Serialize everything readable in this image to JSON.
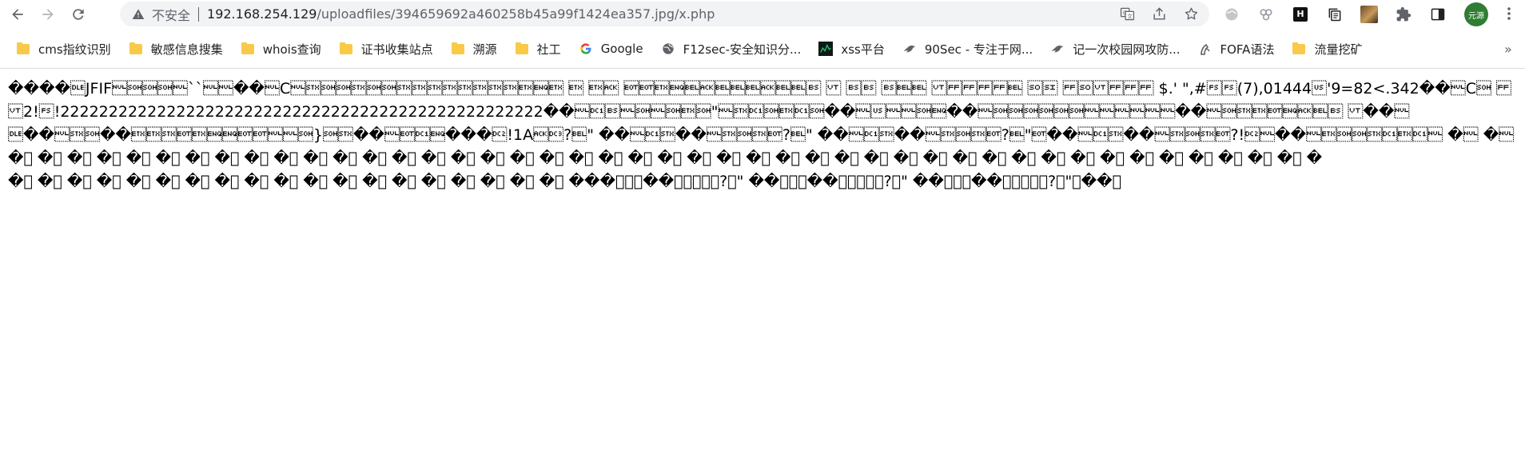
{
  "browser": {
    "security_label": "不安全",
    "url_host": "192.168.254.129",
    "url_path": "/uploadfiles/394659692a460258b45a99f1424ea357.jpg/x.php",
    "avatar_label": "元源",
    "extension_h_label": "H"
  },
  "bookmarks": [
    {
      "label": "cms指纹识别",
      "icon": "folder-icon"
    },
    {
      "label": "敏感信息搜集",
      "icon": "folder-icon"
    },
    {
      "label": "whois查询",
      "icon": "folder-icon"
    },
    {
      "label": "证书收集站点",
      "icon": "folder-icon"
    },
    {
      "label": "溯源",
      "icon": "folder-icon"
    },
    {
      "label": "社工",
      "icon": "folder-icon"
    },
    {
      "label": "Google",
      "icon": "google-icon"
    },
    {
      "label": "F12sec-安全知识分...",
      "icon": "globe-icon"
    },
    {
      "label": "xss平台",
      "icon": "xss-icon"
    },
    {
      "label": "90Sec - 专注于网...",
      "icon": "bird-icon"
    },
    {
      "label": "记一次校园网攻防...",
      "icon": "bird-icon"
    },
    {
      "label": "FOFA语法",
      "icon": "fofa-icon"
    },
    {
      "label": "流量挖矿",
      "icon": "folder-icon"
    }
  ],
  "page": {
    "lines": [
      "����\u0010JFIF\u0000\u0001\u0001\u0001\u0000``\u0000\u0000��\u0000C\u0000\u0002\u0001\u0001\u0002\u0001\u0001\u0002\u0002\u0002\u0002\u0002\u0002\u0002\u0002\u0003\u0005\u0003 \u0003 \u0003\u0006 \u0004\u0004\u0003\u0005\u0007\u0006\u0007\u0007\u0007\u0006\u0007\u0007\b\t\u000b\t\b\b\n\b\u0007\u0007\n\r\n\n\u000b\f\f\f\f\u0007\t\u000e\u000f\r\f\u000e\u000b\f\f\f $.' \",#\u001c\u001c(7),01444\u001f'9=82<.342��\u0000C\u0001 \t\t\t\f",
      "\u000b2!\u001c!22222222222222222222222222222222222222222222222222��\u0000\u0011\b\u0000\u0001\u0000\u0001\u0003\u0001\"\u0000\u0002\u0011\u0001\u0003\u0011\u0001��\u0000\u001f\u0000\u0000\u0001\u0005��\u0000\u0001\u0001\u0001\u0001\u0001\u0001\u0000\u0000\u0000\u0000\u0000\u0000��\u0000\u0001\u0002\u0003\u0004\u0005\u0006\u0007\b\t\n\u000b��\u0000",
      "\u0010��\u0000\u0002\u0001��\u0003\u0003\u0002\u0004\u0003\u0005\u0005\u0004\u0004\u0000\u0000\u0001}\u0001\u0002��\u0000\u0004\u0011\u0005���\u0012!1A\u0006\u0013?\u0007\" ��\u0000\u0011\u0002��\u0000\u0002\u0001\u0002\u0004?\u0007\" ��\u0000\u0011\u0002��\u0000\u0002\u0001\u0002\u0004?\u0007\"\u0004��\u0000\u0011\u0002��\u0000\u0002\u0001\u0002\u0004?!\u0012\u0000��\u0000\u0003\u0001\u0001\u0002\u0011\u0003\u0011\u0000 �\u0000 �\u0000 �\u0000 �\u0000 �\u0000 �\u0000 �\u0000 �",
      "�\u0000 �\u0000 �\u0000 �\u0000 �\u0000 �\u0000 �\u0000 �\u0000 �\u0000 �\u0000 �\u0000 �\u0000 �\u0000 �\u0000 �\u0000 �\u0000 �\u0000 �\u0000 �\u0000 �\u0000 �\u0000 �\u0000 �\u0000 �\u0000 �\u0000 �\u0000 �\u0000 �\u0000 �\u0000 �\u0000 �\u0000 �\u0000 �\u0000 �\u0000 �\u0000 �\u0000 �\u0000 �\u0000 �\u0000 �\u0000 �\u0000 �\u0000 �\u0000 �\u0000 �",
      "�\u0000 �\u0000 �\u0000 �\u0000 �\u0000 �\u0000 �\u0000 �\u0000 �\u0000 �\u0000 �\u0000 �\u0000 �\u0000 �\u0000 �\u0000 �\u0000 �\u0000 �\u0000 �\u0000 ���\u0000\u0011\u0002��\u0000\u0002\u0001\u0002\u0004?\u0007\" ��\u0000\u0011\u0002��\u0000\u0002\u0001\u0002\u0004?\u0007\" ��\u0000\u0011\u0002��\u0000\u0002\u0001\u0002\u0004?\u0007\"\u0004��\u0000"
    ]
  }
}
